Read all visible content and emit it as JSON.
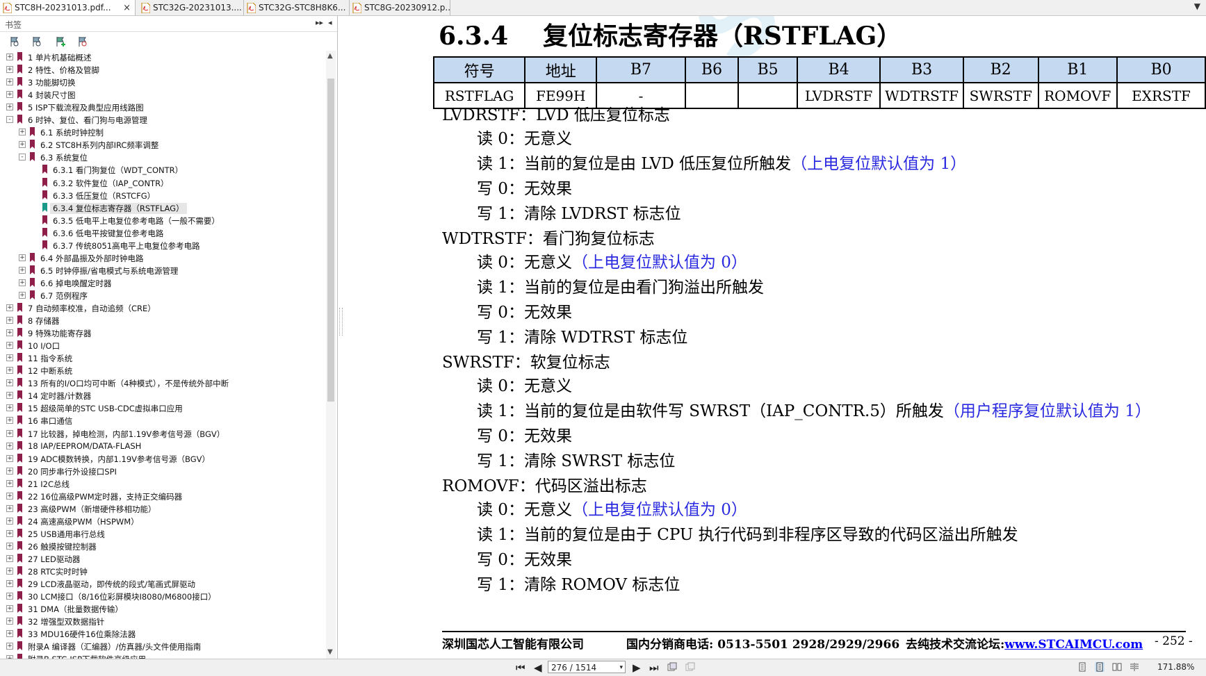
{
  "tabs": [
    {
      "label": "STC8H-20231013.pdf...",
      "close": "×",
      "active": true
    },
    {
      "label": "STC32G-20231013....",
      "close": "",
      "active": false
    },
    {
      "label": "STC32G-STC8H8K6...",
      "close": "",
      "active": false
    },
    {
      "label": "STC8G-20230912.p...",
      "close": "",
      "active": false
    }
  ],
  "tab_dropdown": "▼",
  "sidebar": {
    "title": "书签",
    "expand": "▸▸",
    "close": "◂",
    "scroll_up": "▲",
    "scroll_down": "▼",
    "items": [
      {
        "label": "1 单片机基础概述",
        "level": 0,
        "exp": "+"
      },
      {
        "label": "2 特性、价格及管脚",
        "level": 0,
        "exp": "+"
      },
      {
        "label": "3 功能脚切换",
        "level": 0,
        "exp": "+"
      },
      {
        "label": "4 封装尺寸图",
        "level": 0,
        "exp": "+"
      },
      {
        "label": "5 ISP下载流程及典型应用线路图",
        "level": 0,
        "exp": "+"
      },
      {
        "label": "6 时钟、复位、看门狗与电源管理",
        "level": 0,
        "exp": "-"
      },
      {
        "label": "6.1 系统时钟控制",
        "level": 1,
        "exp": "+"
      },
      {
        "label": "6.2 STC8H系列内部IRC频率调整",
        "level": 1,
        "exp": "+"
      },
      {
        "label": "6.3 系统复位",
        "level": 1,
        "exp": "-"
      },
      {
        "label": "6.3.1 看门狗复位（WDT_CONTR）",
        "level": 2,
        "exp": ""
      },
      {
        "label": "6.3.2 软件复位（IAP_CONTR）",
        "level": 2,
        "exp": ""
      },
      {
        "label": "6.3.3 低压复位（RSTCFG）",
        "level": 2,
        "exp": ""
      },
      {
        "label": "6.3.4 复位标志寄存器（RSTFLAG）",
        "level": 2,
        "exp": "",
        "selected": true
      },
      {
        "label": "6.3.5 低电平上电复位参考电路（一般不需要）",
        "level": 2,
        "exp": ""
      },
      {
        "label": "6.3.6 低电平按键复位参考电路",
        "level": 2,
        "exp": ""
      },
      {
        "label": "6.3.7 传统8051高电平上电复位参考电路",
        "level": 2,
        "exp": ""
      },
      {
        "label": "6.4 外部晶振及外部时钟电路",
        "level": 1,
        "exp": "+"
      },
      {
        "label": "6.5 时钟停振/省电模式与系统电源管理",
        "level": 1,
        "exp": "+"
      },
      {
        "label": "6.6 掉电唤醒定时器",
        "level": 1,
        "exp": "+"
      },
      {
        "label": "6.7 范例程序",
        "level": 1,
        "exp": "+"
      },
      {
        "label": "7 自动频率校准，自动追频（CRE）",
        "level": 0,
        "exp": "+"
      },
      {
        "label": "8 存储器",
        "level": 0,
        "exp": "+"
      },
      {
        "label": "9 特殊功能寄存器",
        "level": 0,
        "exp": "+"
      },
      {
        "label": "10 I/O口",
        "level": 0,
        "exp": "+"
      },
      {
        "label": "11 指令系统",
        "level": 0,
        "exp": "+"
      },
      {
        "label": "12 中断系统",
        "level": 0,
        "exp": "+"
      },
      {
        "label": "13 所有的I/O口均可中断（4种模式），不是传统外部中断",
        "level": 0,
        "exp": "+"
      },
      {
        "label": "14 定时器/计数器",
        "level": 0,
        "exp": "+"
      },
      {
        "label": "15 超级简单的STC USB-CDC虚拟串口应用",
        "level": 0,
        "exp": "+"
      },
      {
        "label": "16 串口通信",
        "level": 0,
        "exp": "+"
      },
      {
        "label": "17 比较器，掉电检测，内部1.19V参考信号源（BGV）",
        "level": 0,
        "exp": "+"
      },
      {
        "label": "18 IAP/EEPROM/DATA-FLASH",
        "level": 0,
        "exp": "+"
      },
      {
        "label": "19 ADC模数转换，内部1.19V参考信号源（BGV）",
        "level": 0,
        "exp": "+"
      },
      {
        "label": "20 同步串行外设接口SPI",
        "level": 0,
        "exp": "+"
      },
      {
        "label": "21 I2C总线",
        "level": 0,
        "exp": "+"
      },
      {
        "label": "22 16位高级PWM定时器，支持正交编码器",
        "level": 0,
        "exp": "+"
      },
      {
        "label": "23 高级PWM（新增硬件移相功能）",
        "level": 0,
        "exp": "+"
      },
      {
        "label": "24 高速高级PWM（HSPWM）",
        "level": 0,
        "exp": "+"
      },
      {
        "label": "25 USB通用串行总线",
        "level": 0,
        "exp": "+"
      },
      {
        "label": "26 触摸按键控制器",
        "level": 0,
        "exp": "+"
      },
      {
        "label": "27 LED驱动器",
        "level": 0,
        "exp": "+"
      },
      {
        "label": "28 RTC实时时钟",
        "level": 0,
        "exp": "+"
      },
      {
        "label": "29 LCD液晶驱动，即传统的段式/笔画式屏驱动",
        "level": 0,
        "exp": "+"
      },
      {
        "label": "30 LCM接口（8/16位彩屏模块I8080/M6800接口）",
        "level": 0,
        "exp": "+"
      },
      {
        "label": "31 DMA（批量数据传输）",
        "level": 0,
        "exp": "+"
      },
      {
        "label": "32 增强型双数据指针",
        "level": 0,
        "exp": "+"
      },
      {
        "label": "33 MDU16硬件16位乘除法器",
        "level": 0,
        "exp": "+"
      },
      {
        "label": "附录A 编译器（汇编器）/仿真器/头文件使用指南",
        "level": 0,
        "exp": "+"
      },
      {
        "label": "附录B STC-ISP下载软件高级应用",
        "level": 0,
        "exp": "+"
      }
    ]
  },
  "document": {
    "watermark": "STCMCU",
    "section_number": "6.3.4",
    "section_title": "复位标志寄存器（RSTFLAG）",
    "table": {
      "headers": [
        "符号",
        "地址",
        "B7",
        "B6",
        "B5",
        "B4",
        "B3",
        "B2",
        "B1",
        "B0"
      ],
      "row": [
        "RSTFLAG",
        "FE99H",
        "-",
        "",
        "",
        "LVDRSTF",
        "WDTRSTF",
        "SWRSTF",
        "ROMOVF",
        "EXRSTF"
      ]
    },
    "flags": [
      {
        "head": "LVDRSTF：LVD 低压复位标志",
        "lines": [
          {
            "text": "读 0：无意义",
            "note": ""
          },
          {
            "text": "读 1：当前的复位是由 LVD 低压复位所触发",
            "note": "（上电复位默认值为 1）"
          },
          {
            "text": "写 0：无效果",
            "note": ""
          },
          {
            "text": "写 1：清除 LVDRST 标志位",
            "note": ""
          }
        ]
      },
      {
        "head": "WDTRSTF：看门狗复位标志",
        "lines": [
          {
            "text": "读 0：无意义",
            "note": "（上电复位默认值为 0）"
          },
          {
            "text": "读 1：当前的复位是由看门狗溢出所触发",
            "note": ""
          },
          {
            "text": "写 0：无效果",
            "note": ""
          },
          {
            "text": "写 1：清除 WDTRST 标志位",
            "note": ""
          }
        ]
      },
      {
        "head": "SWRSTF：软复位标志",
        "lines": [
          {
            "text": "读 0：无意义",
            "note": ""
          },
          {
            "text": "读 1：当前的复位是由软件写 SWRST（IAP_CONTR.5）所触发",
            "note": "（用户程序复位默认值为 1）"
          },
          {
            "text": "写 0：无效果",
            "note": ""
          },
          {
            "text": "写 1：清除 SWRST 标志位",
            "note": ""
          }
        ]
      },
      {
        "head": "ROMOVF：代码区溢出标志",
        "lines": [
          {
            "text": "读 0：无意义",
            "note": "（上电复位默认值为 0）"
          },
          {
            "text": "读 1：当前的复位是由于 CPU 执行代码到非程序区导致的代码区溢出所触发",
            "note": ""
          },
          {
            "text": "写 0：无效果",
            "note": ""
          },
          {
            "text": "写 1：清除 ROMOV 标志位",
            "note": ""
          }
        ]
      }
    ],
    "footer": {
      "company": "深圳国芯人工智能有限公司",
      "phone": "国内分销商电话: 0513-5501 2928/2929/2966",
      "forum_label": "去纯技术交流论坛:",
      "forum_url": "www.STCAIMCU.com",
      "page": "- 252 -"
    }
  },
  "statusbar": {
    "first": "⏮",
    "prev": "◀",
    "page_value": "276 / 1514",
    "page_caret": "▾",
    "next": "▶",
    "last": "⏭",
    "zoom": "171.88%"
  },
  "colors": {
    "table_header": "#c5d9f1",
    "note": "#2a2ae0",
    "bookmark": "#8e1f4b",
    "bookmark_selected": "#1a9a8a"
  }
}
